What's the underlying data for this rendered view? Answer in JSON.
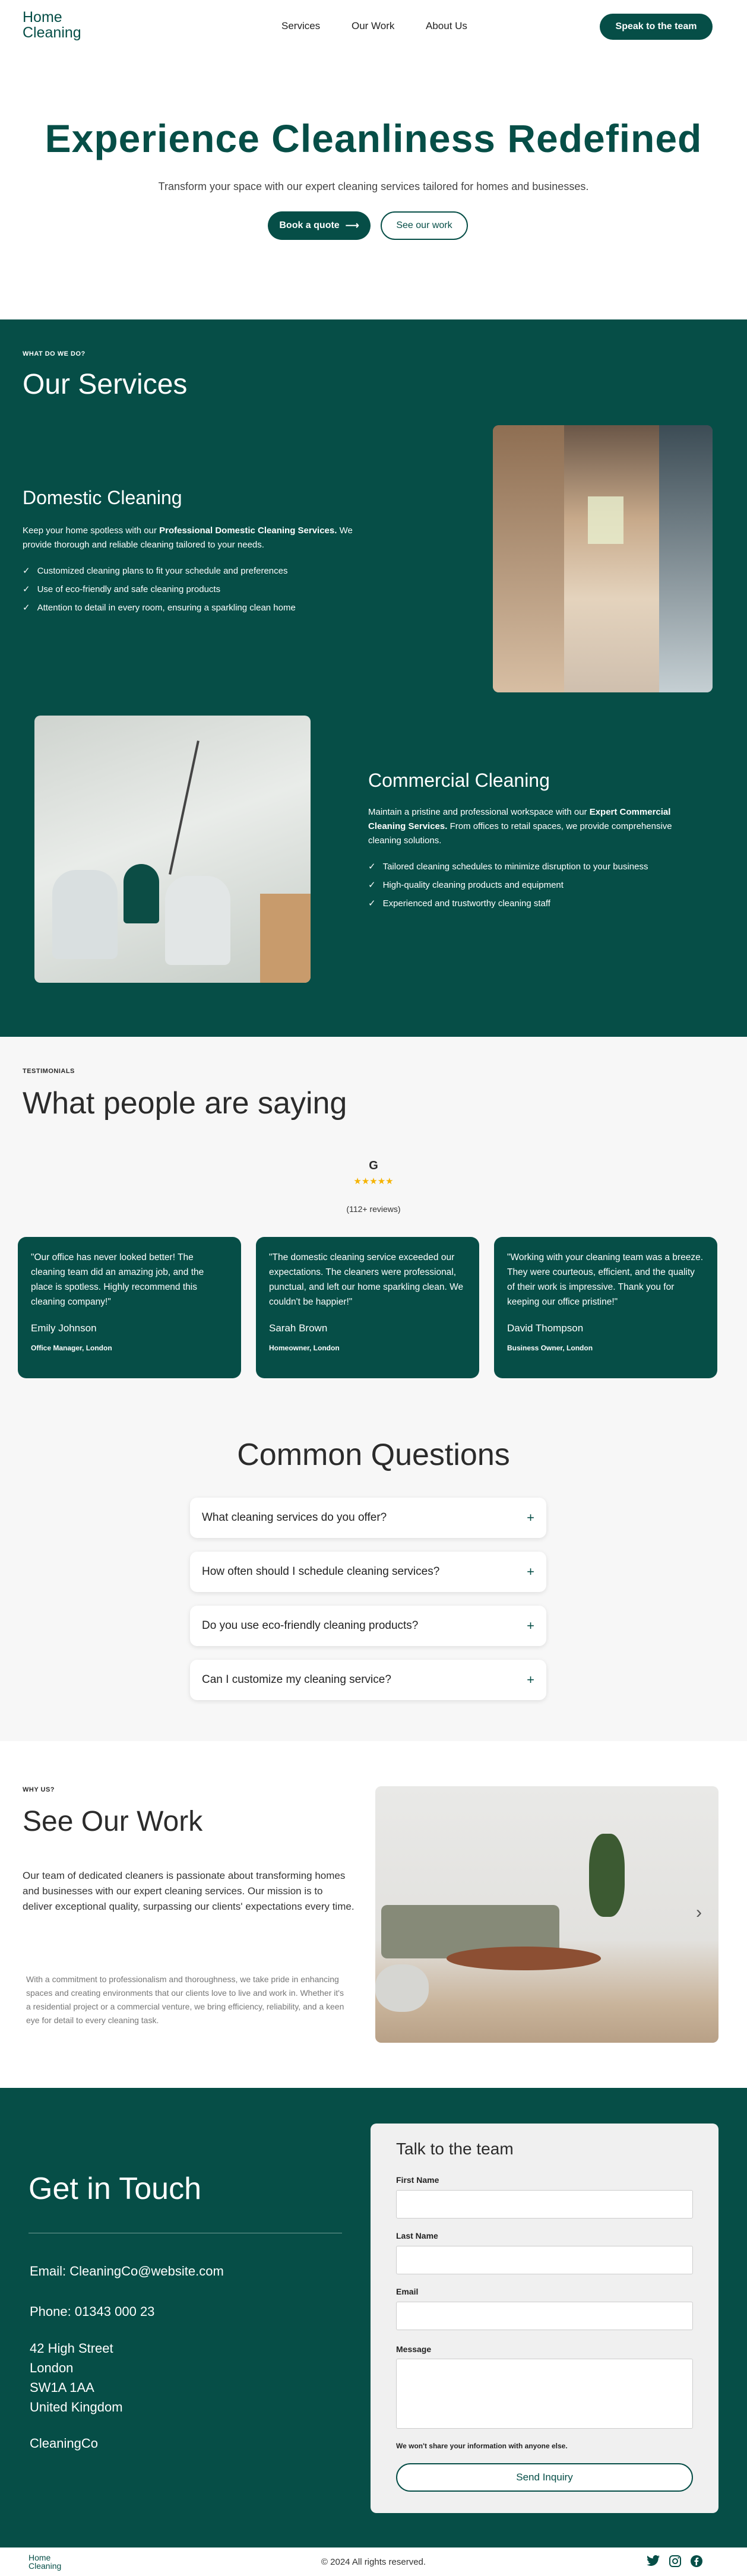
{
  "header": {
    "logo_line1": "Home",
    "logo_line2": "Cleaning",
    "nav": [
      "Services",
      "Our Work",
      "About Us"
    ],
    "cta": "Speak to the team"
  },
  "hero": {
    "title": "Experience Cleanliness Redefined",
    "subtitle": "Transform your space with our expert cleaning services tailored for homes and businesses.",
    "primary": "Book a quote",
    "primary_icon": "arrow-right-icon",
    "secondary": "See our work"
  },
  "services": {
    "eyebrow": "WHAT DO WE DO?",
    "title": "Our Services",
    "domestic": {
      "title": "Domestic Cleaning",
      "desc_pre": "Keep your home spotless with our ",
      "desc_bold": "Professional Domestic Cleaning Services.",
      "desc_post": " We provide thorough and reliable cleaning tailored to your needs.",
      "items": [
        "Customized cleaning plans to fit your schedule and preferences",
        "Use of eco-friendly and safe cleaning products",
        "Attention to detail in every room, ensuring a sparkling clean home"
      ]
    },
    "commercial": {
      "title": "Commercial Cleaning",
      "desc_pre": "Maintain a pristine and professional workspace with our ",
      "desc_bold": "Expert Commercial Cleaning Services.",
      "desc_post": " From offices to retail spaces, we provide comprehensive cleaning solutions.",
      "items": [
        "Tailored cleaning schedules to minimize disruption to your business",
        "High-quality cleaning products and equipment",
        "Experienced and trustworthy cleaning staff"
      ]
    }
  },
  "testimonials": {
    "eyebrow": "TESTIMONIALS",
    "title": "What people are saying",
    "google_letter": "G",
    "stars": "★★★★★",
    "reviews": "(112+ reviews)",
    "items": [
      {
        "quote": "\"Our office has never looked better! The cleaning team did an amazing job, and the place is spotless. Highly recommend this cleaning company!\"",
        "name": "Emily Johnson",
        "role": "Office Manager, London"
      },
      {
        "quote": "\"The domestic cleaning service exceeded our expectations. The cleaners were professional, punctual, and left our home sparkling clean. We couldn't be happier!\"",
        "name": "Sarah Brown",
        "role": "Homeowner, London"
      },
      {
        "quote": "\"Working with your cleaning team was a breeze. They were courteous, efficient, and the quality of their work is impressive. Thank you for keeping our office pristine!\"",
        "name": "David Thompson",
        "role": "Business Owner, London"
      }
    ]
  },
  "faq": {
    "title": "Common Questions",
    "items": [
      "What cleaning services do you offer?",
      "How often should I schedule cleaning services?",
      "Do you use eco-friendly cleaning products?",
      "Can I customize my cleaning service?"
    ],
    "toggle": "+"
  },
  "work": {
    "eyebrow": "WHY US?",
    "title": "See Our Work",
    "lead": "Our team of dedicated cleaners is passionate about transforming homes and businesses with our expert cleaning services. Our mission is to deliver exceptional quality, surpassing our clients' expectations every time.",
    "body": "With a commitment to professionalism and thoroughness, we take pride in enhancing spaces and creating environments that our clients love to live and work in. Whether it's a residential project or a commercial venture, we bring efficiency, reliability, and a keen eye for detail to every cleaning task.",
    "next": "›"
  },
  "contact": {
    "title": "Get in Touch",
    "email": "Email: CleaningCo@website.com",
    "phone": "Phone: 01343 000 23",
    "address": [
      "42 High Street",
      "London",
      "SW1A 1AA",
      "United Kingdom"
    ],
    "company": "CleaningCo",
    "form": {
      "title": "Talk to the team",
      "first": "First Name",
      "last": "Last Name",
      "email": "Email",
      "message": "Message",
      "note": "We won't share your information with anyone else.",
      "submit": "Send Inquiry"
    }
  },
  "footer": {
    "logo_line1": "Home",
    "logo_line2": "Cleaning",
    "copyright": "© 2024 All rights reserved.",
    "social": [
      "twitter-icon",
      "instagram-icon",
      "facebook-icon"
    ]
  },
  "colors": {
    "brand": "#064e47",
    "star": "#f5b301",
    "panel": "#f0f0f0"
  }
}
